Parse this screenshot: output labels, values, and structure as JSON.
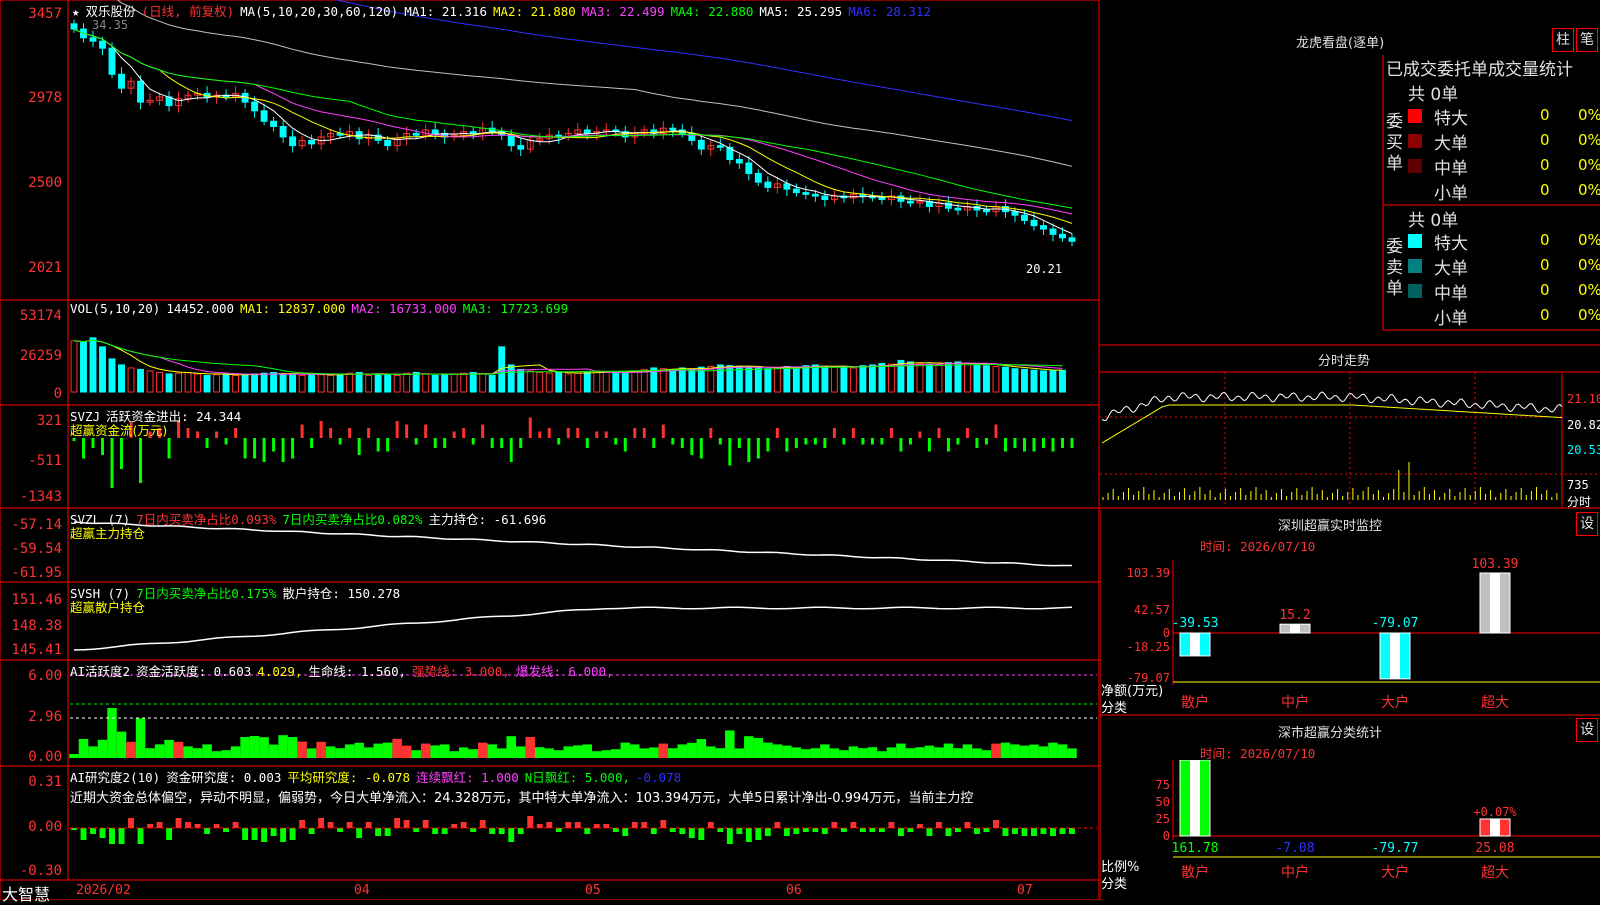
{
  "colors": {
    "up": "#ff3232",
    "down": "#00ffff",
    "grid": "#ff0000",
    "bg": "#000000",
    "ma1": "#ffffff",
    "ma2": "#ffff00",
    "ma3": "#ff40ff",
    "ma4": "#00ff00",
    "ma5": "#c0c0c0",
    "ma6": "#3030ff"
  },
  "main": {
    "star": "★",
    "stock": "双乐股份",
    "period": "(日线, 前复权)",
    "ma_params": "MA(5,10,20,30,60,120)",
    "ma1": "MA1: 21.316",
    "ma2": "MA2: 21.880",
    "ma3": "MA3: 22.499",
    "ma4": "MA4: 22.880",
    "ma5": "MA5: 25.295",
    "ma6": "MA6: 28.312",
    "arrow_down": "↓",
    "arrow_up": "↑",
    "y_ticks": [
      "3457",
      "2978",
      "2500",
      "2021"
    ],
    "high_label": "34.35",
    "low_label": "20.21"
  },
  "vol": {
    "params": "VOL(5,10,20)",
    "value": "14452.000",
    "ma1": "MA1: 12837.000",
    "ma2": "MA2: 16733.000",
    "ma3": "MA3: 17723.699",
    "y_ticks": [
      "53174",
      "26259",
      "0"
    ]
  },
  "svzj": {
    "name": "SVZJ",
    "label": "活跃资金进出: 24.344",
    "sub": "超赢资金流(万元)",
    "y_ticks": [
      "321",
      "-511",
      "-1343"
    ]
  },
  "svzl": {
    "name": "SVZL (7)",
    "a": "7日内买卖净占比0.093%",
    "b": "7日内买卖净占比0.082%",
    "c": "主力持仓: -61.696",
    "sub": "超赢主力持仓",
    "y_ticks": [
      "-57.14",
      "-59.54",
      "-61.95"
    ]
  },
  "svsh": {
    "name": "SVSH (7)",
    "a": "7日内买卖净占比0.175%",
    "b": "散户持仓: 150.278",
    "sub": "超赢散户持仓",
    "y_ticks": [
      "151.46",
      "148.38",
      "145.41"
    ]
  },
  "ai1": {
    "name": "AI活跃度2",
    "a": "资金活跃度: 0.603",
    "b": "4.029,",
    "c": "生命线: 1.560,",
    "d": "强势线: 3.000,",
    "e": "爆发线: 6.000,",
    "y_ticks": [
      "6.00",
      "2.96",
      "0.00"
    ]
  },
  "ai2": {
    "name": "AI研究度2(10)",
    "a": "资金研究度: 0.003",
    "b": "平均研究度: -0.078",
    "c": "连续飘红: 1.000",
    "d": "N日飘红: 5.000,",
    "e": "-0.078",
    "comment": "近期大资金总体偏空，异动不明显，偏弱势，今日大单净流入：24.328万元，其中特大单净流入：103.394万元，大单5日累计净出-0.994万元，当前主力控",
    "y_ticks": [
      "0.31",
      "0.00",
      "-0.30"
    ]
  },
  "xaxis": {
    "brand": "大智慧",
    "labels": [
      "2026/02",
      "04",
      "05",
      "06",
      "07"
    ]
  },
  "dragon": {
    "title": "龙虎看盘(逐单)",
    "btn1": "柱",
    "btn2": "笔",
    "subtitle": "已成交委托单成交量统计",
    "buy_side": "委买单",
    "sell_side": "委卖单",
    "buy_total": "共 0单",
    "sell_total": "共 0单",
    "buy_rows": [
      {
        "label": "特大",
        "num": "0",
        "pct": "0%",
        "color": "#ff0000"
      },
      {
        "label": "大单",
        "num": "0",
        "pct": "0%",
        "color": "#8b0000"
      },
      {
        "label": "中单",
        "num": "0",
        "pct": "0%",
        "color": "#600000"
      },
      {
        "label": "小单",
        "num": "0",
        "pct": "0%",
        "color": "#000000"
      }
    ],
    "sell_rows": [
      {
        "label": "特大",
        "num": "0",
        "pct": "0%",
        "color": "#00ffff"
      },
      {
        "label": "大单",
        "num": "0",
        "pct": "0%",
        "color": "#008080"
      },
      {
        "label": "中单",
        "num": "0",
        "pct": "0%",
        "color": "#006060"
      },
      {
        "label": "小单",
        "num": "0",
        "pct": "0%",
        "color": "#000000"
      }
    ]
  },
  "intraday": {
    "title": "分时走势",
    "prices": [
      "21.10",
      "20.82",
      "20.53"
    ],
    "vol": "735",
    "vol_label": "分时"
  },
  "monitor": {
    "title": "深圳超赢实时监控",
    "btn": "设",
    "time": "时间: 2026/07/10",
    "unit": "净额(万元)",
    "cat": "分类",
    "y_ticks": [
      "103.39",
      "42.57",
      "0",
      "-18.25",
      "-79.07"
    ],
    "bars": [
      {
        "label": "散户",
        "value": "-39.53"
      },
      {
        "label": "中户",
        "value": "15.2"
      },
      {
        "label": "大户",
        "value": "-79.07"
      },
      {
        "label": "超大",
        "value": "103.39"
      }
    ]
  },
  "classify": {
    "title": "深市超赢分类统计",
    "btn": "设",
    "time": "时间: 2026/07/10",
    "unit": "比例%",
    "cat": "分类",
    "y_ticks": [
      "75",
      "50",
      "25",
      "0"
    ],
    "annot": "+0.07%",
    "bars": [
      {
        "label": "散户",
        "value": "161.78"
      },
      {
        "label": "中户",
        "value": "-7.08"
      },
      {
        "label": "大户",
        "value": "-79.77"
      },
      {
        "label": "超大",
        "value": "25.08"
      }
    ]
  },
  "chart_data": {
    "type": "candlestick",
    "closes": [
      33.6,
      33.1,
      32.9,
      32.5,
      31.0,
      30.2,
      30.6,
      29.4,
      29.5,
      29.7,
      29.2,
      29.6,
      29.8,
      29.9,
      29.7,
      29.8,
      29.7,
      29.9,
      29.4,
      28.9,
      28.3,
      28.0,
      27.4,
      26.9,
      27.2,
      27.0,
      27.4,
      27.6,
      27.5,
      27.7,
      27.3,
      27.5,
      27.2,
      26.9,
      27.3,
      27.6,
      27.5,
      27.8,
      27.6,
      27.4,
      27.5,
      27.7,
      27.6,
      27.9,
      27.7,
      27.5,
      26.9,
      26.7,
      27.2,
      27.3,
      27.5,
      27.4,
      27.6,
      27.8,
      27.6,
      27.7,
      27.8,
      27.7,
      27.4,
      27.6,
      27.8,
      27.6,
      27.9,
      27.8,
      27.6,
      27.2,
      26.7,
      26.9,
      26.8,
      26.1,
      25.9,
      25.3,
      24.8,
      24.5,
      24.7,
      24.4,
      24.2,
      24.1,
      24.0,
      23.8,
      24.0,
      23.9,
      24.1,
      24.0,
      23.9,
      23.8,
      24.0,
      23.7,
      23.6,
      23.7,
      23.4,
      23.6,
      23.3,
      23.2,
      23.4,
      23.2,
      23.1,
      23.4,
      23.1,
      22.9,
      22.6,
      22.3,
      22.1,
      21.8,
      21.6,
      21.4
    ],
    "volumes": [
      34000,
      33000,
      36000,
      30000,
      22000,
      18000,
      16000,
      15000,
      14000,
      13000,
      12000,
      12500,
      13000,
      12000,
      11000,
      11500,
      12000,
      11000,
      11500,
      12000,
      12500,
      13000,
      12000,
      11500,
      11000,
      12000,
      11500,
      11000,
      12000,
      12500,
      13000,
      11000,
      12000,
      11500,
      11000,
      12500,
      13000,
      12000,
      11000,
      11500,
      12000,
      12500,
      13000,
      12000,
      11000,
      30000,
      18000,
      15000,
      14000,
      13000,
      12500,
      13000,
      12000,
      12500,
      13000,
      14000,
      13500,
      13000,
      12500,
      14000,
      15000,
      16000,
      15500,
      15000,
      16000,
      15000,
      16500,
      17000,
      18000,
      17500,
      17000,
      16500,
      16000,
      15500,
      16000,
      17000,
      16500,
      17500,
      18000,
      17000,
      16500,
      17000,
      16000,
      17500,
      18000,
      19000,
      18500,
      21000,
      20000,
      19000,
      18500,
      18000,
      19500,
      20000,
      19000,
      18000,
      17500,
      17000,
      16500,
      15500,
      15000,
      14500,
      14000,
      14200,
      14452
    ]
  }
}
